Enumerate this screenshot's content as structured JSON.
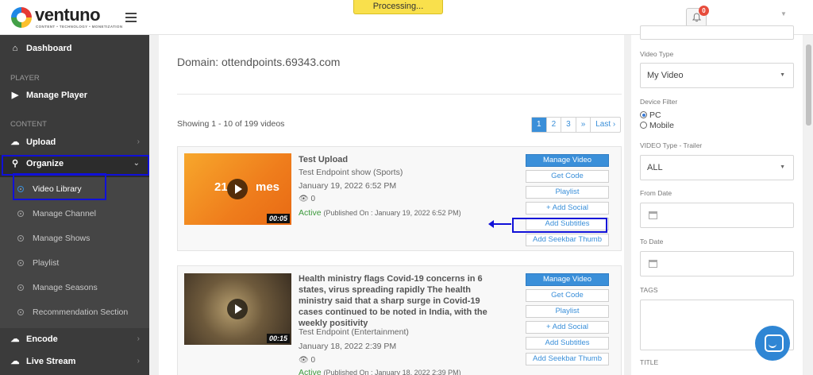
{
  "header": {
    "logo_name": "ventuno",
    "logo_tagline": "CONTENT • TECHNOLOGY • MONETIZATION",
    "processing": "Processing...",
    "notifications_count": "0"
  },
  "sidebar": {
    "dashboard": "Dashboard",
    "section_player": "PLAYER",
    "manage_player": "Manage Player",
    "section_content": "CONTENT",
    "upload": "Upload",
    "organize": "Organize",
    "sub_items": [
      "Video Library",
      "Manage Channel",
      "Manage Shows",
      "Playlist",
      "Manage Seasons",
      "Recommendation Section"
    ],
    "encode": "Encode",
    "live_stream": "Live Stream"
  },
  "main": {
    "domain": "Domain: ottendpoints.69343.com",
    "showing": "Showing 1 - 10 of 199 videos",
    "pagination": [
      "1",
      "2",
      "3",
      "»",
      "Last ›"
    ],
    "videos": [
      {
        "title": "Test Upload",
        "endpoint": "Test Endpoint show (Sports)",
        "date": "January 19, 2022 6:52 PM",
        "views": "0",
        "status": "Active",
        "published": "(Published On : January 19, 2022 6:52 PM)",
        "duration": "00:05",
        "thumb_text_a": "21",
        "thumb_text_b": "mes"
      },
      {
        "title": "Health ministry flags Covid-19 concerns in 6 states, virus spreading rapidly The health ministry said that a sharp surge in Covid-19 cases continued to be noted in India, with the weekly positivity",
        "endpoint": "Test Endpoint (Entertainment)",
        "date": "January 18, 2022 2:39 PM",
        "views": "0",
        "status": "Active",
        "published": "(Published On : January 18, 2022 2:39 PM)",
        "duration": "00:15"
      }
    ],
    "actions": {
      "manage_video": "Manage Video",
      "get_code": "Get Code",
      "playlist": "Playlist",
      "add_social": "+ Add Social",
      "add_subtitles": "Add Subtitles",
      "add_seekbar_thumb": "Add Seekbar Thumb"
    }
  },
  "filters": {
    "video_type_label": "Video Type",
    "video_type_value": "My Video",
    "device_filter_label": "Device Filter",
    "device_pc": "PC",
    "device_mobile": "Mobile",
    "trailer_label": "VIDEO Type - Trailer",
    "trailer_value": "ALL",
    "from_date_label": "From Date",
    "to_date_label": "To Date",
    "tags_label": "TAGS",
    "title_label": "TITLE"
  },
  "colors": {
    "accent": "#3a8fd9",
    "sidebar_bg": "#3b3b3b",
    "processing_bg": "#f9e04c",
    "highlight": "#1010d8",
    "active_status": "#3c9a3c"
  }
}
